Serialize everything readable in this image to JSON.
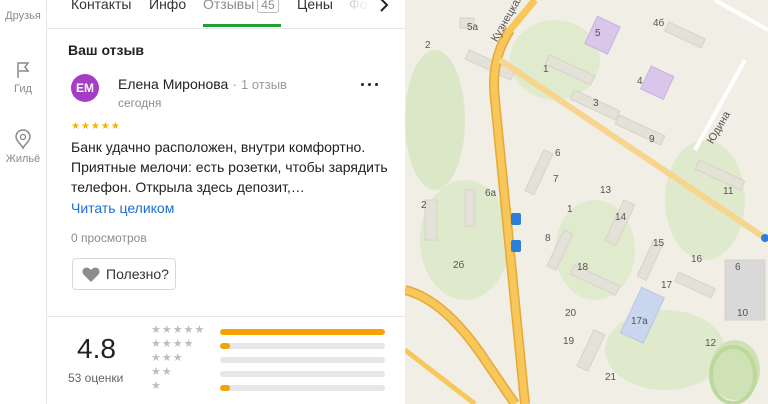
{
  "rail": {
    "items": [
      {
        "label": "Друзья",
        "icon": "friends-icon"
      },
      {
        "label": "Гид",
        "icon": "flag-icon"
      },
      {
        "label": "Жильё",
        "icon": "housing-icon"
      }
    ]
  },
  "tabs": [
    {
      "label": "Контакты"
    },
    {
      "label": "Инфо"
    },
    {
      "label": "Отзывы",
      "count": "45"
    },
    {
      "label": "Цены"
    },
    {
      "label": "Фо"
    }
  ],
  "review": {
    "section_title": "Ваш отзыв",
    "avatar_initials": "ЕМ",
    "avatar_color": "#a53dc7",
    "author": "Елена Миронова",
    "author_reviews": "1 отзыв",
    "date": "сегодня",
    "stars": "★★★★★",
    "text": "Банк удачно расположен, внутри комфортно. Приятные мелочи: есть розетки, чтобы зарядить телефон. Открыла здесь депозит,…",
    "read_more": "Читать целиком",
    "views": "0 просмотров",
    "useful_label": "Полезно?"
  },
  "rating": {
    "value": "4.8",
    "count_label": "53 оценки",
    "distribution": [
      {
        "stars": "★★★★★",
        "fraction": 1.0
      },
      {
        "stars": "★★★★",
        "fraction": 0.06
      },
      {
        "stars": "★★★",
        "fraction": 0.0
      },
      {
        "stars": "★★",
        "fraction": 0.0
      },
      {
        "stars": "★",
        "fraction": 0.06
      }
    ]
  },
  "map": {
    "street_labels": [
      "Кузнецкая",
      "Юдина"
    ],
    "building_numbers": [
      "5а",
      "2",
      "4б",
      "5",
      "1",
      "4",
      "3",
      "9",
      "6",
      "7",
      "6а",
      "2",
      "13",
      "1",
      "14",
      "8",
      "11",
      "15",
      "16",
      "18",
      "17",
      "6",
      "10",
      "2б",
      "20",
      "17а",
      "19",
      "21",
      "12"
    ]
  },
  "colors": {
    "accent_green": "#21a038",
    "link_blue": "#1a6fd4",
    "star_gold": "#f5b400",
    "bar_orange": "#f5a300",
    "road_yellow": "#f5b63a"
  }
}
